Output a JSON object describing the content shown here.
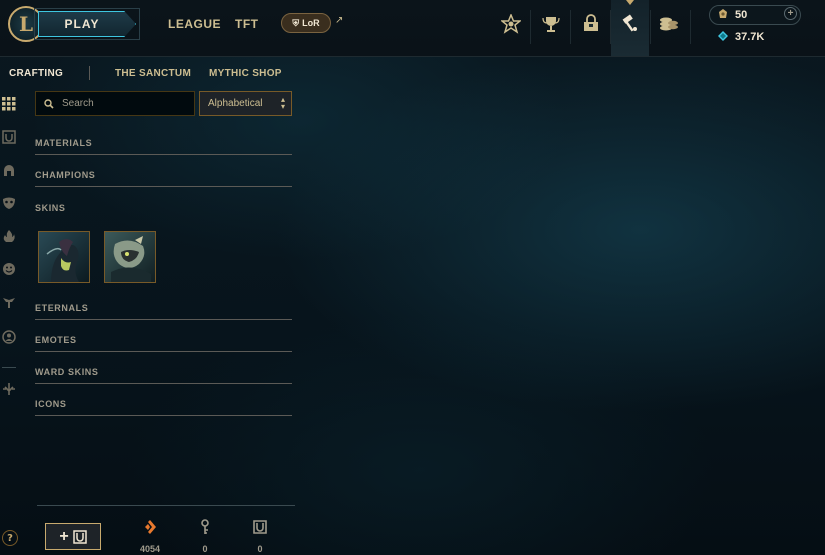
{
  "header": {
    "play_label": "PLAY",
    "nav": [
      "LEAGUE",
      "TFT"
    ],
    "lor_label": "LoR",
    "external_mark": "↗",
    "currencies": {
      "blue_essence_like": "50",
      "rp_like": "37.7K"
    }
  },
  "crafting_nav": {
    "items": [
      "CRAFTING",
      "THE SANCTUM",
      "MYTHIC SHOP"
    ],
    "active_index": 0
  },
  "search": {
    "placeholder": "Search",
    "value": ""
  },
  "sort": {
    "selected": "Alphabetical"
  },
  "categories": {
    "materials": "MATERIALS",
    "champions": "CHAMPIONS",
    "skins": "SKINS",
    "eternals": "ETERNALS",
    "emotes": "EMOTES",
    "ward_skins": "WARD SKINS",
    "icons": "ICONS"
  },
  "skin_shards": [
    {
      "name": "skin-shard-1"
    },
    {
      "name": "skin-shard-2"
    }
  ],
  "footer": {
    "add_label": "+",
    "loot_counts": {
      "orange_essence": "4054",
      "keys": "0",
      "chests": "0"
    },
    "help_label": "?"
  },
  "colors": {
    "gold": "#c8aa6e",
    "gold_text": "#cdbe91",
    "cyan_accent": "#3ec6e0",
    "orange_essence": "#e8792e",
    "background": "#061018"
  }
}
